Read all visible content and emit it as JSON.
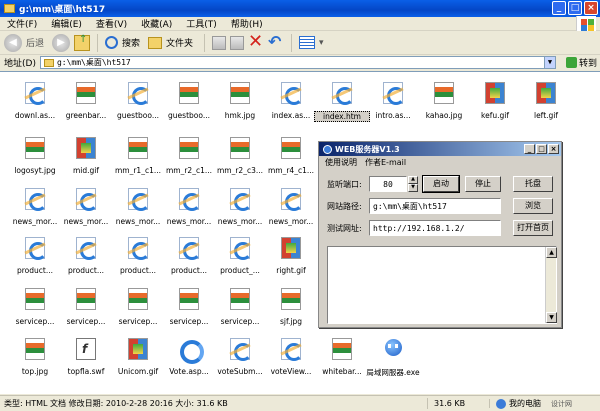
{
  "window": {
    "title": "g:\\mm\\桌面\\ht517",
    "controls": {
      "minimize": "_",
      "maximize": "□",
      "close": "×"
    }
  },
  "menu": [
    "文件(F)",
    "编辑(E)",
    "查看(V)",
    "收藏(A)",
    "工具(T)",
    "帮助(H)"
  ],
  "toolbar": {
    "back": "后退",
    "search": "搜索",
    "folders": "文件夹"
  },
  "address": {
    "label": "地址(D)",
    "value": "g:\\mm\\桌面\\ht517",
    "go": "转到"
  },
  "files": [
    {
      "name": "downl.as...",
      "type": "ie"
    },
    {
      "name": "greenbar...",
      "type": "img"
    },
    {
      "name": "guestboo...",
      "type": "ie"
    },
    {
      "name": "guestboo...",
      "type": "img"
    },
    {
      "name": "hmk.jpg",
      "type": "img"
    },
    {
      "name": "index.as...",
      "type": "ie"
    },
    {
      "name": "index.htm",
      "type": "ie",
      "selected": true
    },
    {
      "name": "intro.as...",
      "type": "ie"
    },
    {
      "name": "kahao.jpg",
      "type": "img"
    },
    {
      "name": "kefu.gif",
      "type": "gif"
    },
    {
      "name": "left.gif",
      "type": "gif"
    },
    {
      "name": "logosyt.jpg",
      "type": "img"
    },
    {
      "name": "mid.gif",
      "type": "gif"
    },
    {
      "name": "mm_r1_c1...",
      "type": "img"
    },
    {
      "name": "mm_r2_c1...",
      "type": "img"
    },
    {
      "name": "mm_r2_c3...",
      "type": "img"
    },
    {
      "name": "mm_r4_c1...",
      "type": "img"
    },
    {
      "name": "news_mor...",
      "type": "ie"
    },
    {
      "name": "news_mor...",
      "type": "ie"
    },
    {
      "name": "news_mor...",
      "type": "ie"
    },
    {
      "name": "news_mor...",
      "type": "ie"
    },
    {
      "name": "news_mor...",
      "type": "ie"
    },
    {
      "name": "news_mor...",
      "type": "ie"
    },
    {
      "name": "product...",
      "type": "ie"
    },
    {
      "name": "product...",
      "type": "ie"
    },
    {
      "name": "product...",
      "type": "ie"
    },
    {
      "name": "product...",
      "type": "ie"
    },
    {
      "name": "product_...",
      "type": "ie"
    },
    {
      "name": "right.gif",
      "type": "gif"
    },
    {
      "name": "servicep...",
      "type": "img"
    },
    {
      "name": "servicep...",
      "type": "img"
    },
    {
      "name": "servicep...",
      "type": "img"
    },
    {
      "name": "servicep...",
      "type": "img"
    },
    {
      "name": "servicep...",
      "type": "img"
    },
    {
      "name": "sjf.jpg",
      "type": "img"
    },
    {
      "name": "top.jpg",
      "type": "img"
    },
    {
      "name": "topfla.swf",
      "type": "swf"
    },
    {
      "name": "Unicom.gif",
      "type": "gif"
    },
    {
      "name": "Vote.asp...",
      "type": "ie-big"
    },
    {
      "name": "voteSubm...",
      "type": "ie"
    },
    {
      "name": "voteView...",
      "type": "ie"
    },
    {
      "name": "whitebar...",
      "type": "img"
    },
    {
      "name": "局域网服器.exe",
      "type": "exe"
    }
  ],
  "dialog": {
    "title": "WEB服务器V1.3",
    "menu": [
      "使用说明",
      "作者E-mail"
    ],
    "port_label": "监听端口:",
    "port_value": "80",
    "path_label": "网站路径:",
    "path_value": "g:\\mm\\桌面\\ht517",
    "url_label": "测试网址:",
    "url_value": "http://192.168.1.2/",
    "start": "启动",
    "stop": "停止",
    "tray": "托盘",
    "browse": "浏览",
    "open_home": "打开首页",
    "scroll_up": "▲",
    "scroll_down": "▼"
  },
  "status": {
    "left": "类型: HTML 文档 修改日期: 2010-2-28 20:16 大小: 31.6 KB",
    "size": "31.6 KB",
    "zone": "我的电脑",
    "tray": "设计网"
  }
}
